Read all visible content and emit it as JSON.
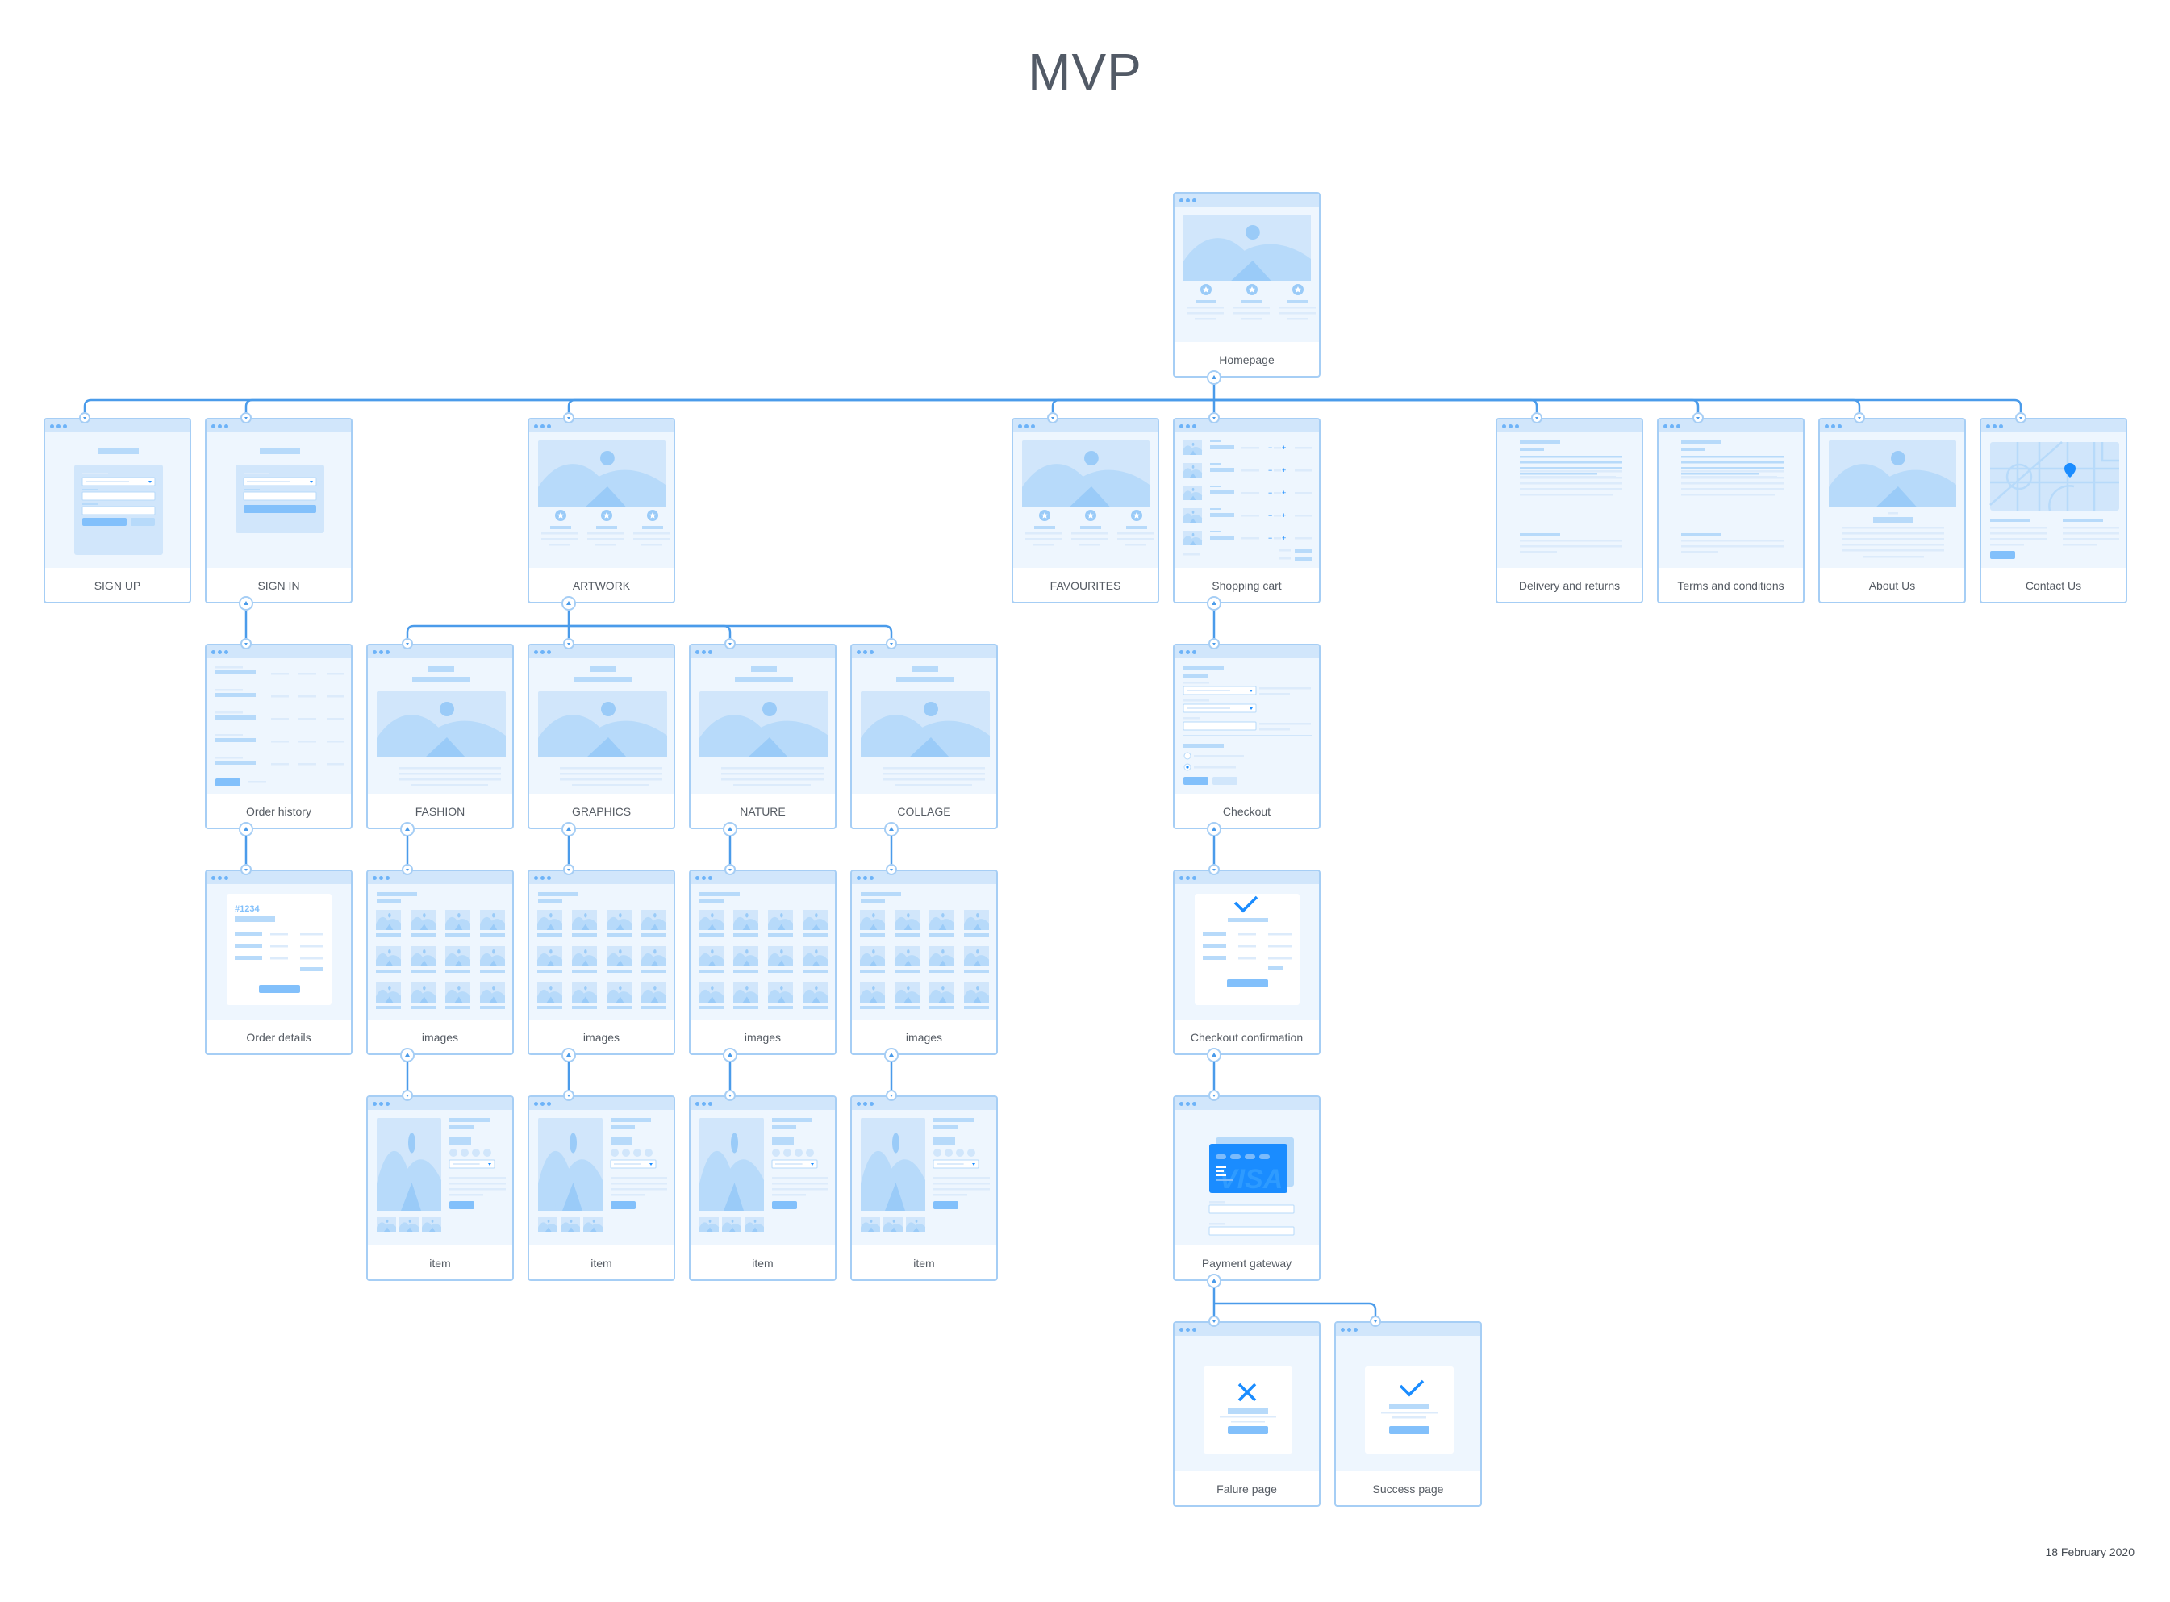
{
  "title": "MVP",
  "date": "18 February 2020",
  "colors": {
    "connector": "#4A9BEA",
    "card_border": "#A6CEF5",
    "card_header": "#D1E6FB",
    "card_body": "#EEF6FE",
    "accent": "#1A8CFF"
  },
  "pages": [
    {
      "id": "homepage",
      "label": "Homepage",
      "template": "landing",
      "parent": null
    },
    {
      "id": "sign-up",
      "label": "SIGN UP",
      "template": "signup",
      "parent": "homepage"
    },
    {
      "id": "sign-in",
      "label": "SIGN IN",
      "template": "signin",
      "parent": "homepage"
    },
    {
      "id": "artwork",
      "label": "ARTWORK",
      "template": "landing",
      "parent": "homepage"
    },
    {
      "id": "favourites",
      "label": "FAVOURITES",
      "template": "landing",
      "parent": "homepage"
    },
    {
      "id": "shopping-cart",
      "label": "Shopping cart",
      "template": "cart",
      "parent": "homepage"
    },
    {
      "id": "delivery-and-returns",
      "label": "Delivery and returns",
      "template": "text",
      "parent": "homepage"
    },
    {
      "id": "terms-and-conditions",
      "label": "Terms and conditions",
      "template": "text",
      "parent": "homepage"
    },
    {
      "id": "about-us",
      "label": "About Us",
      "template": "about",
      "parent": "homepage"
    },
    {
      "id": "contact-us",
      "label": "Contact Us",
      "template": "map",
      "parent": "homepage"
    },
    {
      "id": "order-history",
      "label": "Order history",
      "template": "history",
      "parent": "sign-in"
    },
    {
      "id": "fashion",
      "label": "FASHION",
      "template": "category",
      "parent": "artwork"
    },
    {
      "id": "graphics",
      "label": "GRAPHICS",
      "template": "category",
      "parent": "artwork"
    },
    {
      "id": "nature",
      "label": "NATURE",
      "template": "category",
      "parent": "artwork"
    },
    {
      "id": "collage",
      "label": "COLLAGE",
      "template": "category",
      "parent": "artwork"
    },
    {
      "id": "checkout",
      "label": "Checkout",
      "template": "checkout",
      "parent": "shopping-cart"
    },
    {
      "id": "order-details",
      "label": "Order details",
      "template": "order",
      "parent": "order-history",
      "order_number": "#1234"
    },
    {
      "id": "fashion-images",
      "label": "images",
      "template": "grid",
      "parent": "fashion"
    },
    {
      "id": "graphics-images",
      "label": "images",
      "template": "grid",
      "parent": "graphics"
    },
    {
      "id": "nature-images",
      "label": "images",
      "template": "grid",
      "parent": "nature"
    },
    {
      "id": "collage-images",
      "label": "images",
      "template": "grid",
      "parent": "collage"
    },
    {
      "id": "checkout-confirmation",
      "label": "Checkout confirmation",
      "template": "confirm",
      "parent": "checkout"
    },
    {
      "id": "fashion-item",
      "label": "item",
      "template": "item",
      "parent": "fashion-images"
    },
    {
      "id": "graphics-item",
      "label": "item",
      "template": "item",
      "parent": "graphics-images"
    },
    {
      "id": "nature-item",
      "label": "item",
      "template": "item",
      "parent": "nature-images"
    },
    {
      "id": "collage-item",
      "label": "item",
      "template": "item",
      "parent": "collage-images"
    },
    {
      "id": "payment-gateway",
      "label": "Payment gateway",
      "template": "payment",
      "parent": "checkout-confirmation",
      "card_brand": "VISA"
    },
    {
      "id": "failure-page",
      "label": "Falure page",
      "template": "fail",
      "parent": "payment-gateway"
    },
    {
      "id": "success-page",
      "label": "Success page",
      "template": "success",
      "parent": "payment-gateway"
    }
  ]
}
